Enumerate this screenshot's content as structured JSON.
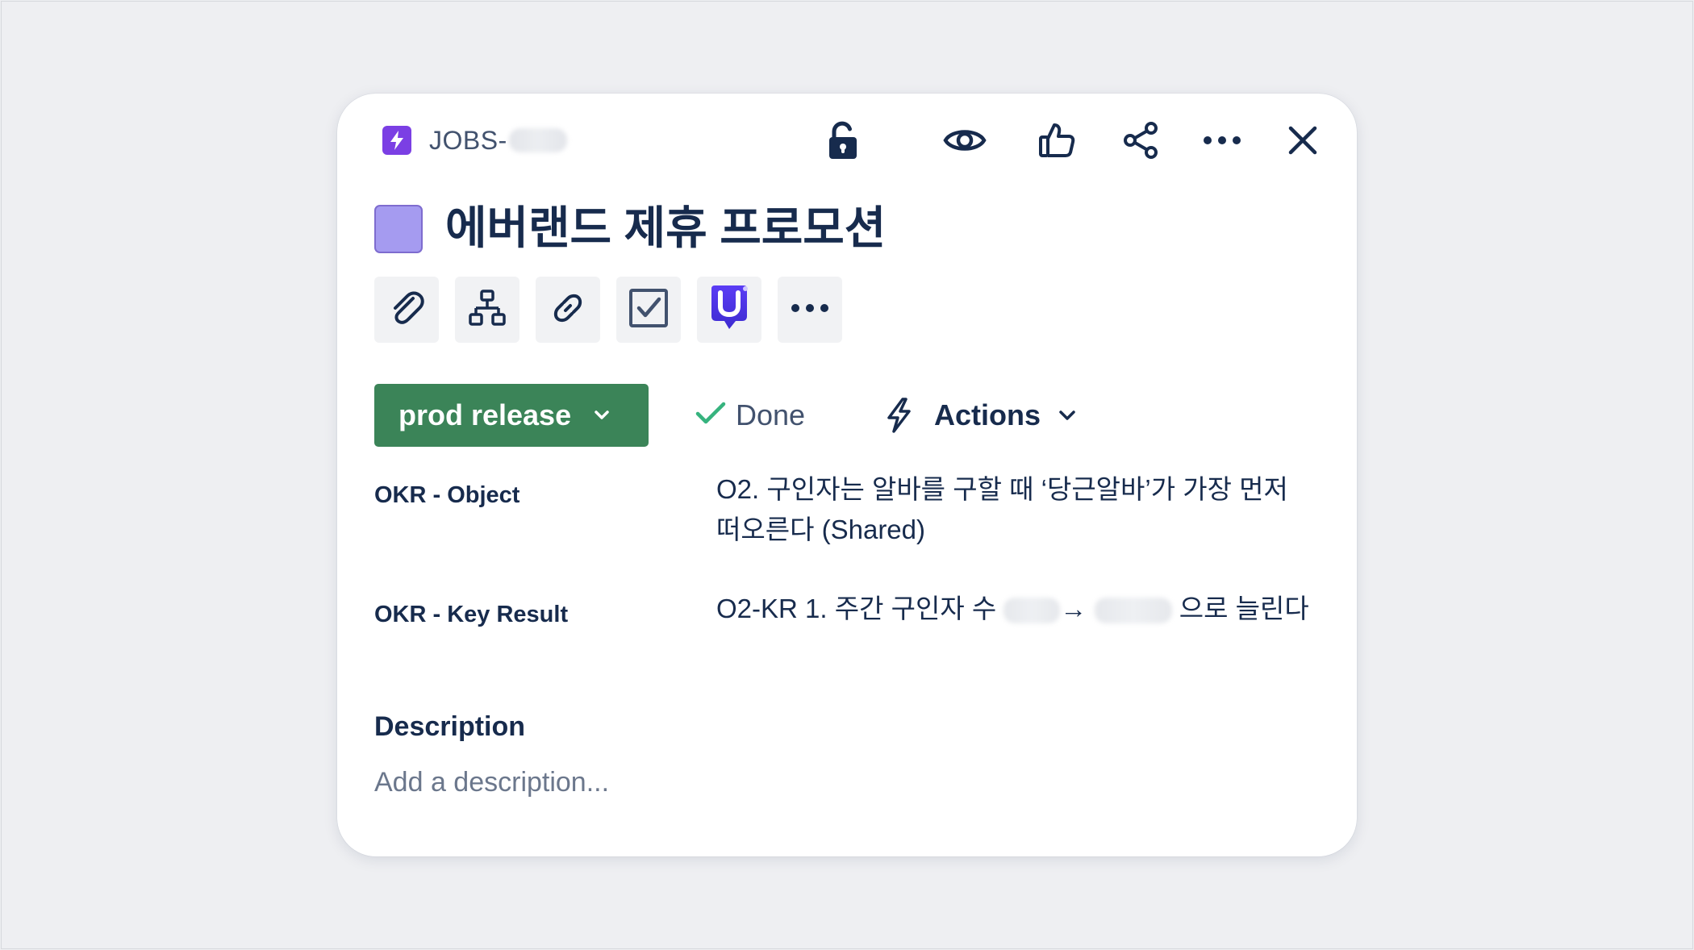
{
  "issue": {
    "key_prefix": "JOBS-",
    "title": "에버랜드 제휴 프로모션"
  },
  "colors": {
    "issue_type_bg": "#7b3fe4",
    "swatch": "#a59bf0",
    "status_bg": "#3b8458",
    "done_check": "#36b37e",
    "text": "#172b4d",
    "muted": "#6b778c"
  },
  "header_actions": {
    "icons": [
      "unlock-icon",
      "eye-icon",
      "thumbs-up-icon",
      "share-icon",
      "more-icon",
      "close-icon"
    ]
  },
  "toolbar": {
    "icons": [
      "attachment-icon",
      "child-issues-icon",
      "link-icon",
      "checklist-icon",
      "app-u-icon",
      "more-icon"
    ]
  },
  "status": {
    "label": "prod release",
    "done_label": "Done",
    "actions_label": "Actions"
  },
  "fields": [
    {
      "label": "OKR - Object",
      "value": "O2. 구인자는 알바를 구할 때 ‘당근알바’가 가장 먼저 떠오른다 (Shared)"
    },
    {
      "label": "OKR - Key Result",
      "value_prefix": "O2-KR 1. 주간 구인자 수",
      "arrow": "→",
      "value_suffix": "으로 늘린다"
    }
  ],
  "description": {
    "title": "Description",
    "placeholder": "Add a description..."
  }
}
